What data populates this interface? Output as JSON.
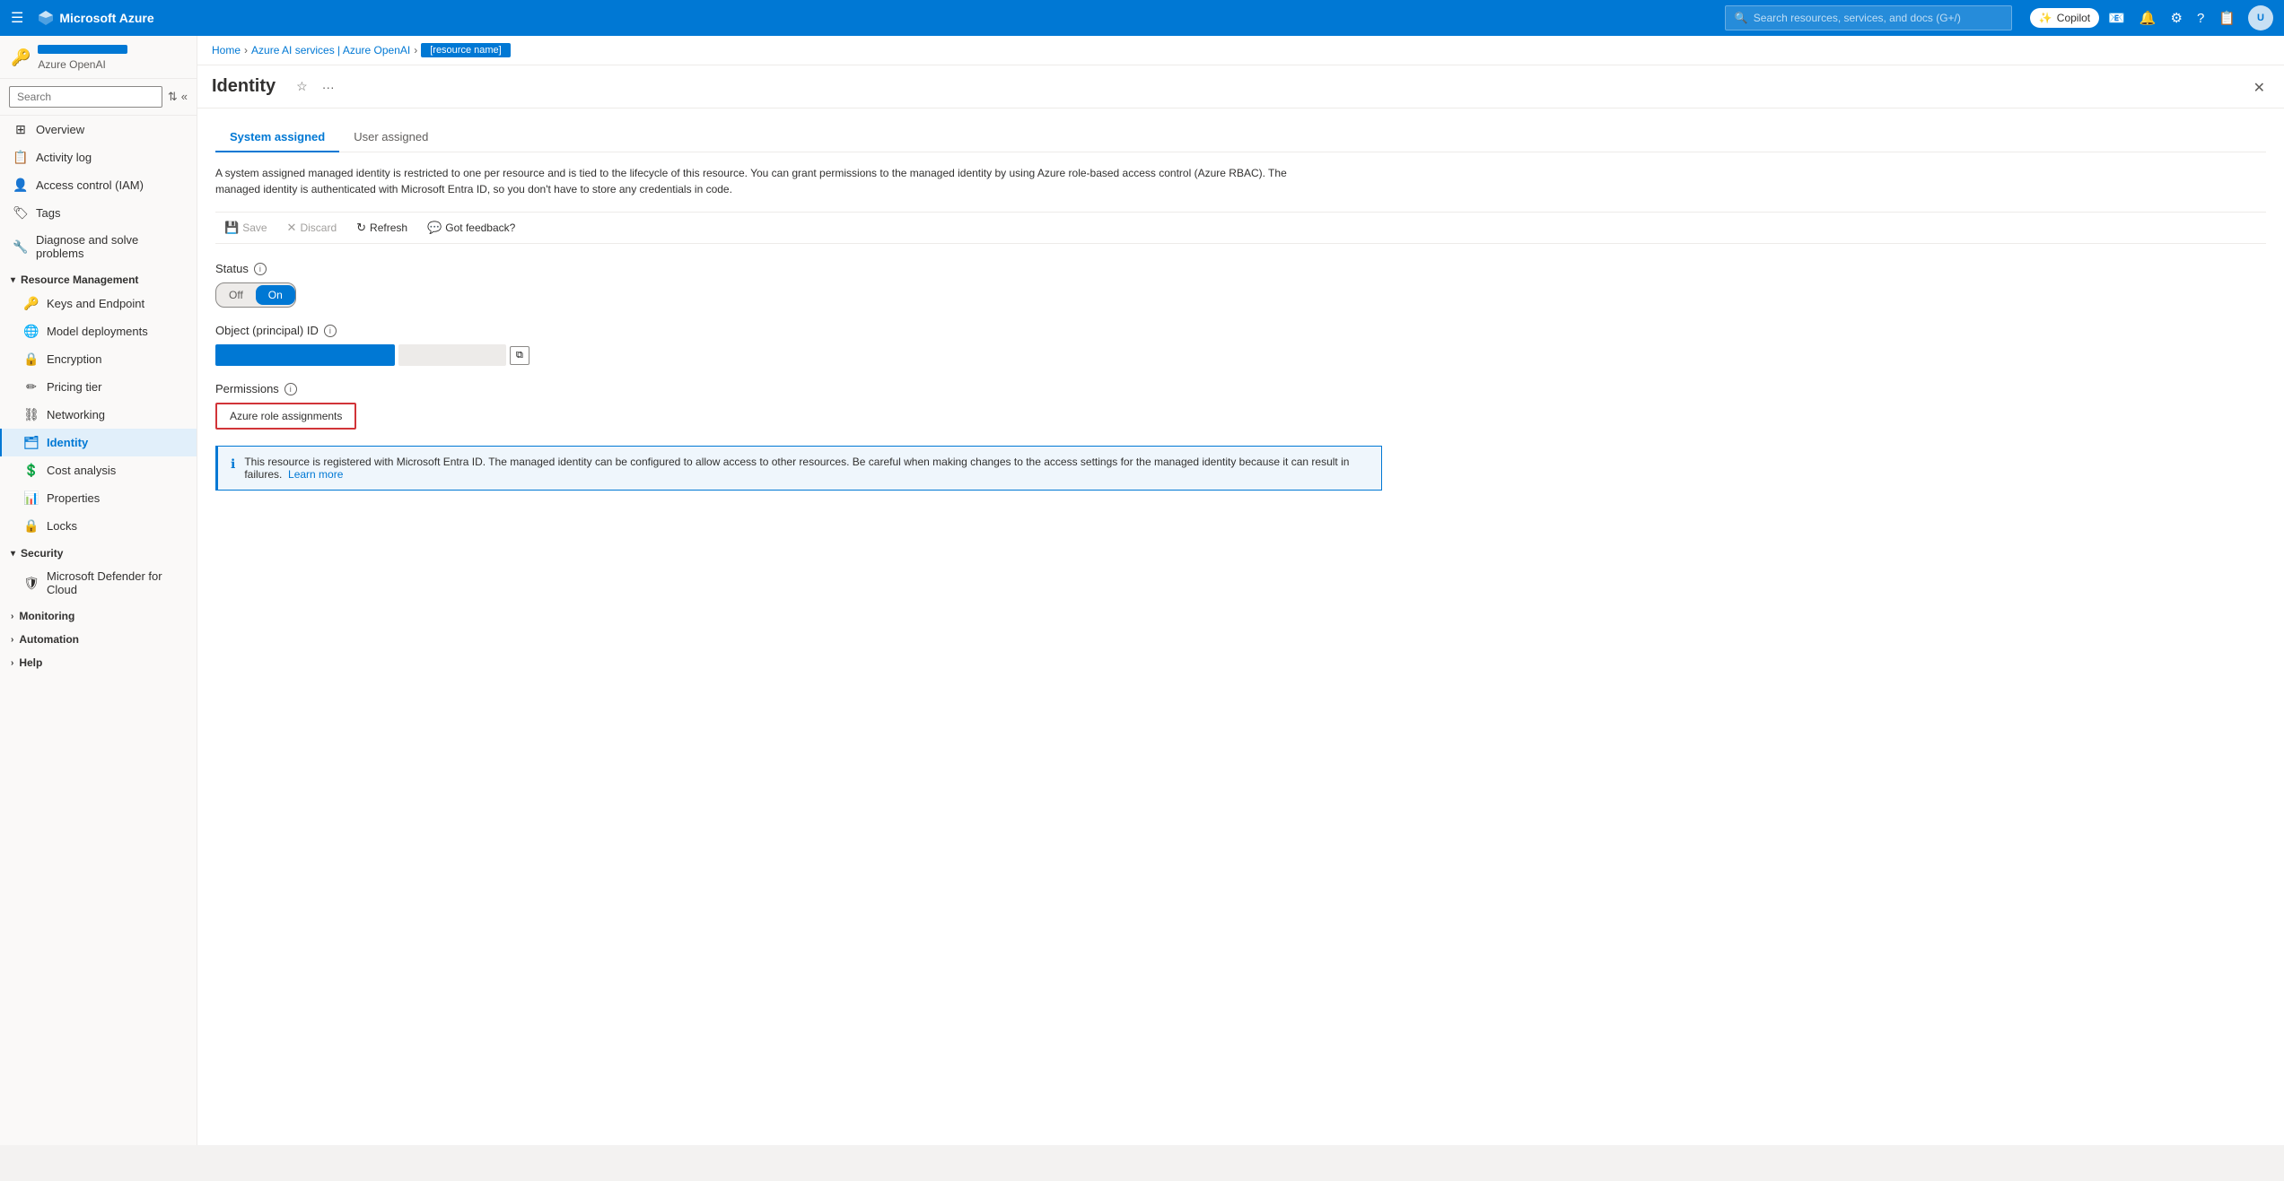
{
  "topbar": {
    "hamburger_icon": "☰",
    "logo_text": "Microsoft Azure",
    "search_placeholder": "Search resources, services, and docs (G+/)",
    "copilot_label": "Copilot",
    "icons": [
      "📧",
      "🔔",
      "⚙",
      "?",
      "📋"
    ],
    "avatar_initials": "U"
  },
  "breadcrumb": {
    "home": "Home",
    "services": "Azure AI services | Azure OpenAI",
    "current": "[resource name]"
  },
  "sidebar": {
    "resource_icon": "🔑",
    "resource_subtitle": "Azure OpenAI",
    "search_placeholder": "Search",
    "nav_items": [
      {
        "id": "overview",
        "label": "Overview",
        "icon": "⊞"
      },
      {
        "id": "activity-log",
        "label": "Activity log",
        "icon": "📋"
      },
      {
        "id": "access-control",
        "label": "Access control (IAM)",
        "icon": "👤"
      },
      {
        "id": "tags",
        "label": "Tags",
        "icon": "🏷"
      },
      {
        "id": "diagnose",
        "label": "Diagnose and solve problems",
        "icon": "🔧"
      }
    ],
    "resource_management": {
      "header": "Resource Management",
      "items": [
        {
          "id": "keys-endpoint",
          "label": "Keys and Endpoint",
          "icon": "🔑"
        },
        {
          "id": "model-deployments",
          "label": "Model deployments",
          "icon": "🌐"
        },
        {
          "id": "encryption",
          "label": "Encryption",
          "icon": "🔒"
        },
        {
          "id": "pricing-tier",
          "label": "Pricing tier",
          "icon": "✏"
        },
        {
          "id": "networking",
          "label": "Networking",
          "icon": "⛓"
        },
        {
          "id": "identity",
          "label": "Identity",
          "icon": "🗂"
        },
        {
          "id": "cost-analysis",
          "label": "Cost analysis",
          "icon": "💲"
        },
        {
          "id": "properties",
          "label": "Properties",
          "icon": "📊"
        },
        {
          "id": "locks",
          "label": "Locks",
          "icon": "🔒"
        }
      ]
    },
    "security": {
      "header": "Security",
      "items": [
        {
          "id": "defender",
          "label": "Microsoft Defender for Cloud",
          "icon": "🛡"
        }
      ]
    },
    "monitoring": {
      "header": "Monitoring"
    },
    "automation": {
      "header": "Automation"
    },
    "help": {
      "header": "Help"
    }
  },
  "page": {
    "title": "Identity",
    "star_icon": "☆",
    "more_icon": "···",
    "close_icon": "✕"
  },
  "tabs": {
    "system_assigned": "System assigned",
    "user_assigned": "User assigned"
  },
  "description": "A system assigned managed identity is restricted to one per resource and is tied to the lifecycle of this resource. You can grant permissions to the managed identity by using Azure role-based access control (Azure RBAC). The managed identity is authenticated with Microsoft Entra ID, so you don't have to store any credentials in code.",
  "toolbar": {
    "save": {
      "label": "Save",
      "icon": "💾"
    },
    "discard": {
      "label": "Discard",
      "icon": "✕"
    },
    "refresh": {
      "label": "Refresh",
      "icon": "↻"
    },
    "feedback": {
      "label": "Got feedback?",
      "icon": "💬"
    }
  },
  "status": {
    "label": "Status",
    "off_label": "Off",
    "on_label": "On",
    "current": "on"
  },
  "object_id": {
    "label": "Object (principal) ID"
  },
  "permissions": {
    "label": "Permissions",
    "button_label": "Azure role assignments"
  },
  "info_banner": {
    "icon": "ℹ",
    "text": "This resource is registered with Microsoft Entra ID. The managed identity can be configured to allow access to other resources. Be careful when making changes to the access settings for the managed identity because it can result in failures.",
    "link_text": "Learn more",
    "link_href": "#"
  }
}
